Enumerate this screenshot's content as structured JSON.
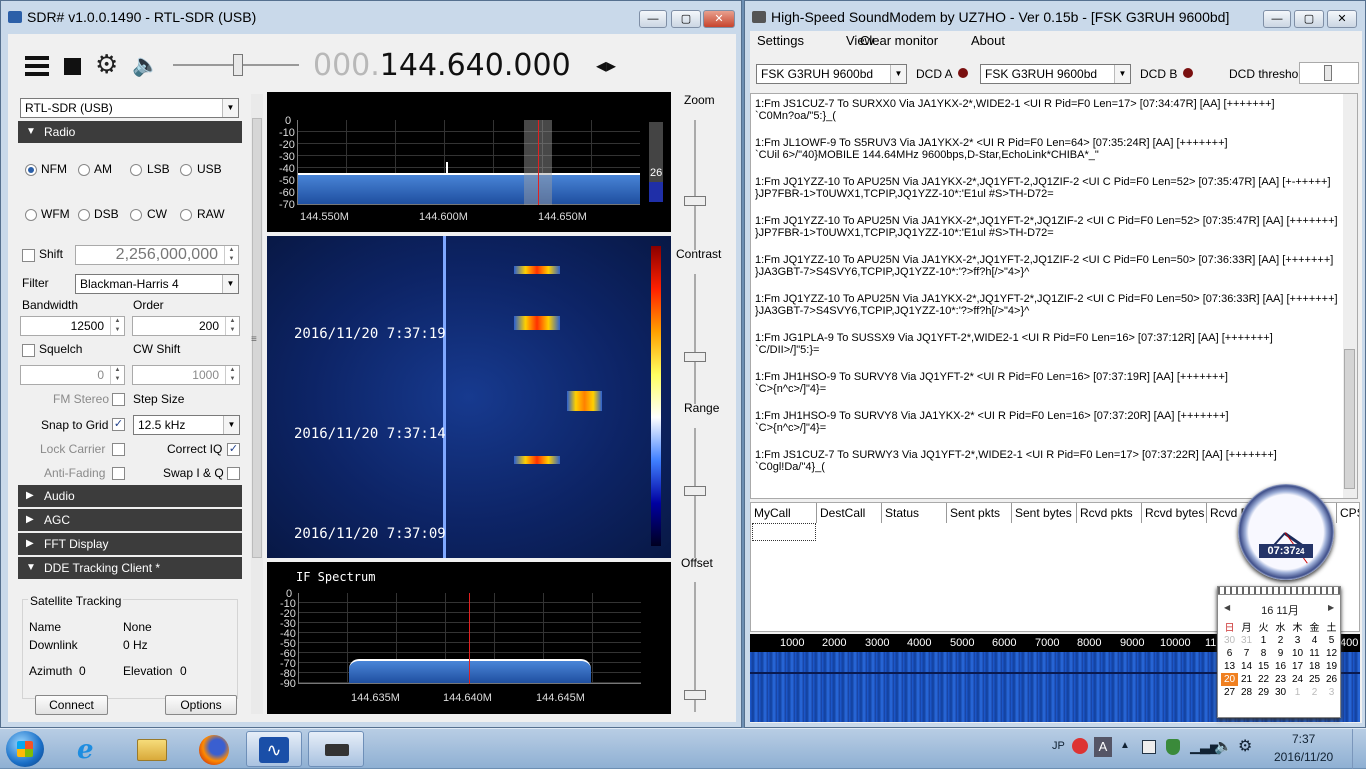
{
  "sdr": {
    "title": "SDR# v1.0.0.1490 - RTL-SDR (USB)",
    "freq_prefix": "000.",
    "freq_main": "144.640.000",
    "device": "RTL-SDR (USB)",
    "sections": {
      "radio": "Radio",
      "audio": "Audio",
      "agc": "AGC",
      "fft": "FFT Display",
      "dde": "DDE Tracking Client *"
    },
    "modes": [
      "NFM",
      "AM",
      "LSB",
      "USB",
      "WFM",
      "DSB",
      "CW",
      "RAW"
    ],
    "shift_label": "Shift",
    "shift_value": "2,256,000,000",
    "filter_label": "Filter",
    "filter_value": "Blackman-Harris 4",
    "bandwidth_label": "Bandwidth",
    "order_label": "Order",
    "bandwidth_value": "12500",
    "order_value": "200",
    "squelch_label": "Squelch",
    "cwshift_label": "CW Shift",
    "squelch_value": "0",
    "cwshift_value": "1000",
    "fm_stereo": "FM Stereo",
    "step_size": "Step Size",
    "snap": "Snap to Grid",
    "snap_value": "12.5 kHz",
    "lock_carrier": "Lock Carrier",
    "correct_iq": "Correct IQ",
    "anti_fading": "Anti-Fading",
    "swap_iq": "Swap I & Q",
    "sat_tracking": "Satellite Tracking",
    "name_label": "Name",
    "name_value": "None",
    "downlink_label": "Downlink",
    "downlink_value": "0 Hz",
    "azimuth_label": "Azimuth",
    "azimuth_value": "0",
    "elevation_label": "Elevation",
    "elevation_value": "0",
    "connect": "Connect",
    "options": "Options",
    "zoom": "Zoom",
    "contrast": "Contrast",
    "range": "Range",
    "offset": "Offset",
    "spectrum_y": [
      "0",
      "-10",
      "-20",
      "-30",
      "-40",
      "-50",
      "-60",
      "-70"
    ],
    "spectrum_x": [
      "144.550M",
      "144.600M",
      "144.650M"
    ],
    "level_value": "26",
    "wf_times": [
      "2016/11/20 7:37:19",
      "2016/11/20 7:37:14",
      "2016/11/20 7:37:09"
    ],
    "if_title": "IF Spectrum",
    "if_y": [
      "0",
      "-10",
      "-20",
      "-30",
      "-40",
      "-50",
      "-60",
      "-70",
      "-80",
      "-90"
    ],
    "if_x": [
      "144.635M",
      "144.640M",
      "144.645M"
    ]
  },
  "sm": {
    "title": "High-Speed SoundModem by UZ7HO - Ver 0.15b - [FSK G3RUH 9600bd]",
    "menu": [
      "Settings",
      "View",
      "Clear monitor",
      "About"
    ],
    "modem_a": "FSK G3RUH 9600bd",
    "dcd_a": "DCD A",
    "modem_b": "FSK G3RUH 9600bd",
    "dcd_b": "DCD B",
    "dcd_threshold": "DCD threshold",
    "messages": [
      [
        "1:Fm JS1CUZ-7 To SURXX0 Via JA1YKX-2*,WIDE2-1 <UI R Pid=F0 Len=17> [07:34:47R] [AA] [+++++++]",
        "`C0Mn?oa/\"5:}_("
      ],
      [
        "1:Fm JL1OWF-9 To S5RUV3 Via JA1YKX-2* <UI R Pid=F0 Len=64> [07:35:24R] [AA] [+++++++]",
        "`CUil 6>/\"40}MOBILE 144.64MHz 9600bps,D-Star,EchoLink*CHIBA*_\""
      ],
      [
        "1:Fm JQ1YZZ-10 To APU25N Via JA1YKX-2*,JQ1YFT-2,JQ1ZIF-2 <UI C Pid=F0 Len=52> [07:35:47R] [AA] [+-+++++]",
        "}JP7FBR-1>T0UWX1,TCPIP,JQ1YZZ-10*:'E1ul #S>TH-D72="
      ],
      [
        "1:Fm JQ1YZZ-10 To APU25N Via JA1YKX-2*,JQ1YFT-2*,JQ1ZIF-2 <UI C Pid=F0 Len=52> [07:35:47R] [AA] [+++++++]",
        "}JP7FBR-1>T0UWX1,TCPIP,JQ1YZZ-10*:'E1ul #S>TH-D72="
      ],
      [
        "1:Fm JQ1YZZ-10 To APU25N Via JA1YKX-2*,JQ1YFT-2,JQ1ZIF-2 <UI C Pid=F0 Len=50> [07:36:33R] [AA] [+++++++]",
        "}JA3GBT-7>S4SVY6,TCPIP,JQ1YZZ-10*:'?>ff?h[/>\"4>}^"
      ],
      [
        "1:Fm JQ1YZZ-10 To APU25N Via JA1YKX-2*,JQ1YFT-2*,JQ1ZIF-2 <UI C Pid=F0 Len=50> [07:36:33R] [AA] [+++++++]",
        "}JA3GBT-7>S4SVY6,TCPIP,JQ1YZZ-10*:'?>ff?h[/>\"4>}^"
      ],
      [
        "1:Fm JG1PLA-9 To SUSSX9 Via JQ1YFT-2*,WIDE2-1 <UI R Pid=F0 Len=16> [07:37:12R] [AA] [+++++++]",
        "`C/DII>/]\"5:}="
      ],
      [
        "1:Fm JH1HSO-9 To SURVY8 Via JQ1YFT-2* <UI R Pid=F0 Len=16> [07:37:19R] [AA] [+++++++]",
        "`C>{n^c>/]\"4}="
      ],
      [
        "1:Fm JH1HSO-9 To SURVY8 Via JA1YKX-2* <UI R Pid=F0 Len=16> [07:37:20R] [AA] [+++++++]",
        "`C>{n^c>/]\"4}="
      ],
      [
        "1:Fm JS1CUZ-7 To SURWY3 Via JQ1YFT-2*,WIDE2-1 <UI R Pid=F0 Len=17> [07:37:22R] [AA] [+++++++]",
        "`C0gl!Da/\"4}_("
      ]
    ],
    "columns": [
      "MyCall",
      "DestCall",
      "Status",
      "Sent pkts",
      "Sent bytes",
      "Rcvd pkts",
      "Rcvd bytes",
      "Rcvd FC",
      "CPS"
    ],
    "freq_scale": [
      "1000",
      "2000",
      "3000",
      "4000",
      "5000",
      "6000",
      "7000",
      "8000",
      "9000",
      "10000",
      "11",
      "400"
    ]
  },
  "clock": {
    "digital": "07:37",
    "seconds": "24"
  },
  "calendar": {
    "month": "16 11月",
    "weekdays": [
      "日",
      "月",
      "火",
      "水",
      "木",
      "金",
      "土"
    ],
    "rows": [
      [
        "30",
        "31",
        "1",
        "2",
        "3",
        "4",
        "5"
      ],
      [
        "6",
        "7",
        "8",
        "9",
        "10",
        "11",
        "12"
      ],
      [
        "13",
        "14",
        "15",
        "16",
        "17",
        "18",
        "19"
      ],
      [
        "20",
        "21",
        "22",
        "23",
        "24",
        "25",
        "26"
      ],
      [
        "27",
        "28",
        "29",
        "30",
        "1",
        "2",
        "3"
      ]
    ],
    "today": "20"
  },
  "taskbar": {
    "ime": "JP",
    "ime_mode": "A",
    "time": "7:37",
    "date": "2016/11/20"
  },
  "colors": {
    "accent": "#2b5fa8",
    "spectrum_fill": "#2a5db0",
    "marker": "#e02020",
    "section": "#3c3c3c"
  }
}
